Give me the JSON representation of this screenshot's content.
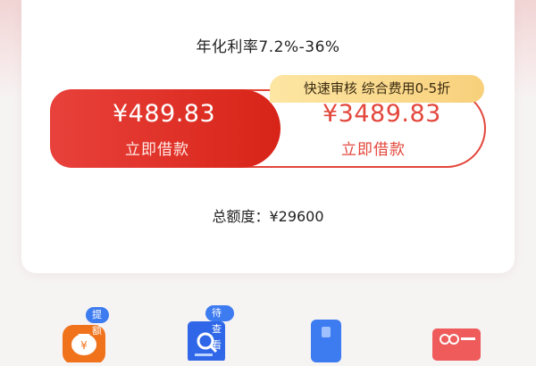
{
  "rate_text": "年化利率7.2%-36%",
  "promo_badge": "快速审核 综合费用0-5折",
  "loan_options": [
    {
      "amount": "¥489.83",
      "action": "立即借款"
    },
    {
      "amount": "¥3489.83",
      "action": "立即借款"
    }
  ],
  "total_limit": "总额度：¥29600",
  "icons": [
    {
      "name": "money-bag-icon",
      "badge": "提额"
    },
    {
      "name": "document-search-icon",
      "badge": "待查看"
    },
    {
      "name": "phone-card-icon"
    },
    {
      "name": "gift-coupon-icon"
    }
  ],
  "colors": {
    "primary_red": "#e3463b",
    "gold": "#f8d07b",
    "blue": "#3d7bf0"
  }
}
